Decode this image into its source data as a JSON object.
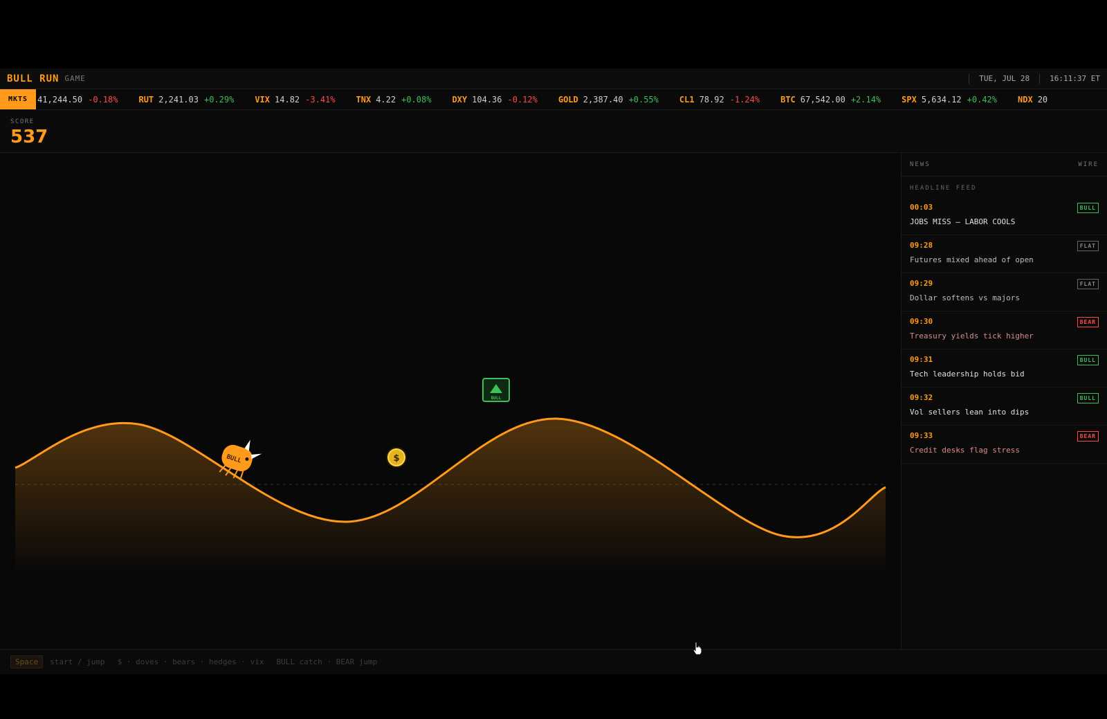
{
  "topbar": {
    "brand": "BULL RUN",
    "brand_sub": "GAME",
    "date": "TUE, JUL 28",
    "time": "16:11:37 ET"
  },
  "ticker": {
    "label": "MKTS",
    "items": [
      {
        "sym": "",
        "val": "41,244.50",
        "chg": "-0.18%",
        "dir": "down"
      },
      {
        "sym": "RUT",
        "val": "2,241.03",
        "chg": "+0.29%",
        "dir": "up"
      },
      {
        "sym": "VIX",
        "val": "14.82",
        "chg": "-3.41%",
        "dir": "down"
      },
      {
        "sym": "TNX",
        "val": "4.22",
        "chg": "+0.08%",
        "dir": "up"
      },
      {
        "sym": "DXY",
        "val": "104.36",
        "chg": "-0.12%",
        "dir": "down"
      },
      {
        "sym": "GOLD",
        "val": "2,387.40",
        "chg": "+0.55%",
        "dir": "up"
      },
      {
        "sym": "CL1",
        "val": "78.92",
        "chg": "-1.24%",
        "dir": "down"
      },
      {
        "sym": "BTC",
        "val": "67,542.00",
        "chg": "+2.14%",
        "dir": "up"
      },
      {
        "sym": "SPX",
        "val": "5,634.12",
        "chg": "+0.42%",
        "dir": "up"
      },
      {
        "sym": "NDX",
        "val": "20",
        "chg": "",
        "dir": "up"
      }
    ]
  },
  "score": {
    "label": "SCORE",
    "value": "537"
  },
  "game": {
    "player_label": "BULL",
    "coin_symbol": "$",
    "powerup_label": "BULL",
    "line_color": "#ff9a1a",
    "powerup_color": "#3fbf5a"
  },
  "news": {
    "title": "NEWS",
    "subtitle": "WIRE",
    "feed_title": "HEADLINE FEED",
    "items": [
      {
        "time": "00:03",
        "text": "JOBS MISS — LABOR COOLS",
        "tag": "BULL",
        "kind": "bull"
      },
      {
        "time": "09:28",
        "text": "Futures mixed ahead of open",
        "tag": "FLAT",
        "kind": "flat"
      },
      {
        "time": "09:29",
        "text": "Dollar softens vs majors",
        "tag": "FLAT",
        "kind": "flat"
      },
      {
        "time": "09:30",
        "text": "Treasury yields tick higher",
        "tag": "BEAR",
        "kind": "bear"
      },
      {
        "time": "09:31",
        "text": "Tech leadership holds bid",
        "tag": "BULL",
        "kind": "bull"
      },
      {
        "time": "09:32",
        "text": "Vol sellers lean into dips",
        "tag": "BULL",
        "kind": "bull"
      },
      {
        "time": "09:33",
        "text": "Credit desks flag stress",
        "tag": "BEAR",
        "kind": "bear"
      }
    ]
  },
  "footer": {
    "key": "Space",
    "hints": [
      "start / jump",
      "$ · doves · bears · hedges · vix",
      "BULL catch · BEAR jump"
    ]
  }
}
